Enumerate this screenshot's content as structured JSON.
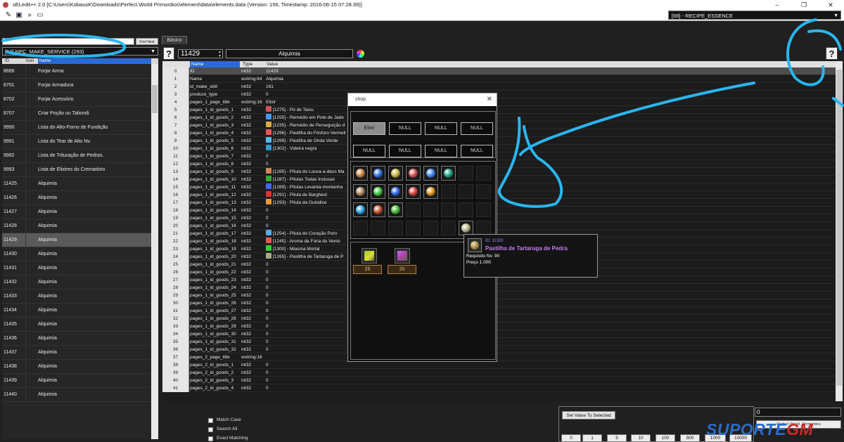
{
  "titlebar": {
    "title": "sELedit++ 2.0 [C:\\Users\\KobausK\\Downloads\\Perfect World  Primordios\\element\\data\\elements.data (Version: 156, Timestamp: 2016-06-15 07:28:39)]",
    "minimize": "–",
    "maximize": "❐",
    "close": "✕"
  },
  "toolbar": {
    "list_selector": "[69] - RECIPE_ESSENCE"
  },
  "left": {
    "search_value": "",
    "find_next_label": "Find Next",
    "category": "[54] NPC_MAKE_SERVICE (293)",
    "headers": {
      "id": "ID",
      "icon": "Icon",
      "name": "Name"
    },
    "rows": [
      {
        "id": "8666",
        "name": "Forjar Arma"
      },
      {
        "id": "8701",
        "name": "Forjar Armadura"
      },
      {
        "id": "8702",
        "name": "Forjar Acessório"
      },
      {
        "id": "8707",
        "name": "Criar Poção ou Talismã"
      },
      {
        "id": "9990",
        "name": "Lista do Alto-Forno de Fundição"
      },
      {
        "id": "9991",
        "name": "Lista do Tear de Alto Nv."
      },
      {
        "id": "9992",
        "name": "Lista de Trituração de Pedras."
      },
      {
        "id": "9993",
        "name": "Lista de Elixires do Crematório"
      },
      {
        "id": "11425",
        "name": "Alquimia"
      },
      {
        "id": "11426",
        "name": "Alquimia"
      },
      {
        "id": "11427",
        "name": "Alquimia"
      },
      {
        "id": "11428",
        "name": "Alquimia"
      },
      {
        "id": "11429",
        "name": "Alquimia"
      },
      {
        "id": "11430",
        "name": "Alquimia"
      },
      {
        "id": "11431",
        "name": "Alquimia"
      },
      {
        "id": "11432",
        "name": "Alquimia"
      },
      {
        "id": "11433",
        "name": "Alquimia"
      },
      {
        "id": "11434",
        "name": "Alquimia"
      },
      {
        "id": "11435",
        "name": "Alquimia"
      },
      {
        "id": "11436",
        "name": "Alquimia"
      },
      {
        "id": "11437",
        "name": "Alquimia"
      },
      {
        "id": "11438",
        "name": "Alquimia"
      },
      {
        "id": "11439",
        "name": "Alquimia"
      },
      {
        "id": "11440",
        "name": "Alquimia"
      }
    ]
  },
  "editor": {
    "tab_label": "Básico",
    "help_label": "?",
    "item_id": "11429",
    "item_name": "Alquimia"
  },
  "grid": {
    "headers": {
      "name": "Name",
      "type": "Type",
      "value": "Value"
    },
    "rows": [
      [
        "0",
        "ID",
        "int32",
        "11429"
      ],
      [
        "1",
        "Name",
        "wstring:64",
        "Alquimia"
      ],
      [
        "2",
        "id_make_skill",
        "int32",
        "161"
      ],
      [
        "3",
        "produce_type",
        "int32",
        "0"
      ],
      [
        "4",
        "pages_1_page_title",
        "wstring:16",
        "Elixir"
      ],
      [
        "5",
        "pages_1_id_goods_1",
        "int32",
        "[1275] - Pó de Taixu"
      ],
      [
        "6",
        "pages_1_id_goods_2",
        "int32",
        "[1255] - Remédio em Pote de Jade"
      ],
      [
        "7",
        "pages_1_id_goods_3",
        "int32",
        "[1235] - Remédio de Perseguição d"
      ],
      [
        "8",
        "pages_1_id_goods_4",
        "int32",
        "[1296] - Pastilha do Fósforo Vermell"
      ],
      [
        "9",
        "pages_1_id_goods_5",
        "int32",
        "[1299] - Pastilha de Onda Verde"
      ],
      [
        "10",
        "pages_1_id_goods_6",
        "int32",
        "[1302] - Videira negra"
      ],
      [
        "11",
        "pages_1_id_goods_7",
        "int32",
        "0"
      ],
      [
        "12",
        "pages_1_id_goods_8",
        "int32",
        "0"
      ],
      [
        "13",
        "pages_1_id_goods_9",
        "int32",
        "[1285] - Pílula do Louva-a-deus Ma"
      ],
      [
        "14",
        "pages_1_id_goods_10",
        "int32",
        "[1287] - Pílulas Todas Inclusas"
      ],
      [
        "15",
        "pages_1_id_goods_11",
        "int32",
        "[1289] - Pílulas Levanta-montanha"
      ],
      [
        "16",
        "pages_1_id_goods_12",
        "int32",
        "[1291] - Pílula de Barghest"
      ],
      [
        "17",
        "pages_1_id_goods_13",
        "int32",
        "[1293] - Pílula da Gulodice"
      ],
      [
        "18",
        "pages_1_id_goods_14",
        "int32",
        "0"
      ],
      [
        "19",
        "pages_1_id_goods_15",
        "int32",
        "0"
      ],
      [
        "20",
        "pages_1_id_goods_16",
        "int32",
        "0"
      ],
      [
        "21",
        "pages_1_id_goods_17",
        "int32",
        "[1254] - Pílula do Coração Puro"
      ],
      [
        "22",
        "pages_1_id_goods_18",
        "int32",
        "[1245] - Aroma da Fúria do Vento"
      ],
      [
        "23",
        "pages_1_id_goods_19",
        "int32",
        "[1300] - Miasma Mortal"
      ],
      [
        "24",
        "pages_1_id_goods_20",
        "int32",
        "[1265] - Pastilha de Tartaruga de P"
      ],
      [
        "25",
        "pages_1_id_goods_21",
        "int32",
        "0"
      ],
      [
        "26",
        "pages_1_id_goods_22",
        "int32",
        "0"
      ],
      [
        "27",
        "pages_1_id_goods_23",
        "int32",
        "0"
      ],
      [
        "28",
        "pages_1_id_goods_24",
        "int32",
        "0"
      ],
      [
        "29",
        "pages_1_id_goods_25",
        "int32",
        "0"
      ],
      [
        "30",
        "pages_1_id_goods_26",
        "int32",
        "0"
      ],
      [
        "31",
        "pages_1_id_goods_27",
        "int32",
        "0"
      ],
      [
        "32",
        "pages_1_id_goods_28",
        "int32",
        "0"
      ],
      [
        "33",
        "pages_1_id_goods_29",
        "int32",
        "0"
      ],
      [
        "34",
        "pages_1_id_goods_30",
        "int32",
        "0"
      ],
      [
        "35",
        "pages_1_id_goods_31",
        "int32",
        "0"
      ],
      [
        "36",
        "pages_1_id_goods_32",
        "int32",
        "0"
      ],
      [
        "37",
        "pages_2_page_title",
        "wstring:16",
        ""
      ],
      [
        "38",
        "pages_2_id_goods_1",
        "int32",
        "0"
      ],
      [
        "39",
        "pages_2_id_goods_2",
        "int32",
        "0"
      ],
      [
        "40",
        "pages_2_id_goods_3",
        "int32",
        "0"
      ],
      [
        "41",
        "pages_2_id_goods_4",
        "int32",
        "0"
      ]
    ]
  },
  "shop": {
    "title": "shop",
    "close": "✕",
    "tabs": [
      "Elixir",
      "NULL",
      "NULL",
      "NULL",
      "NULL",
      "NULL",
      "NULL",
      "NULL"
    ],
    "material_counts": [
      "25",
      "20"
    ],
    "tooltip": {
      "id_line": "ID: 11320",
      "name": "Pastilha de Tartaruga de Pedra",
      "requirement": "Requisito Nv. 90",
      "price": "Preço 1.000"
    }
  },
  "bottom": {
    "match_case": "Match Case",
    "search_all": "Search All",
    "exact_matching": "Exact Matching",
    "set_value_label": "Set Value To Selected",
    "value_input": "0",
    "quick_values": [
      "0",
      "1",
      "5",
      "10",
      "100",
      "500",
      "1000",
      "10000"
    ],
    "pw_label": "Perfect World_Primordios",
    "watermark_main": "SUPORTE",
    "watermark_accent": "GM"
  },
  "colors": {
    "selection_blue": "#2a6ad8",
    "annotation_cyan": "#29b6f0",
    "tooltip_name": "#c080f0"
  }
}
